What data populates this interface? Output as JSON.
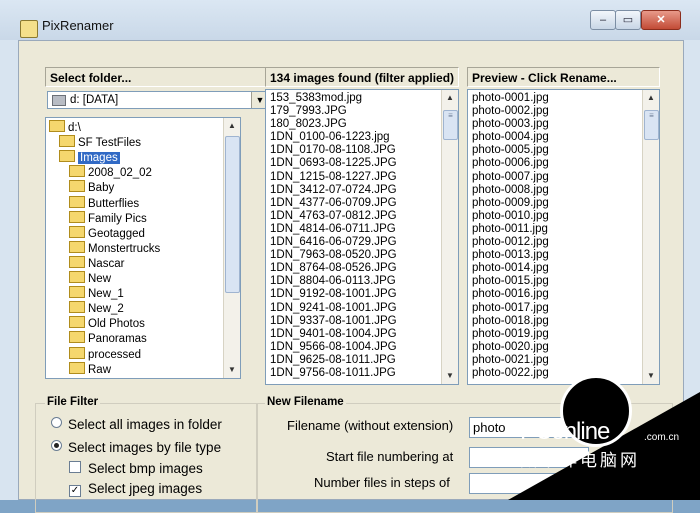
{
  "window": {
    "title": "PixRenamer",
    "controls": {
      "minimize": "–",
      "maximize": "▭",
      "close": "✕"
    }
  },
  "folder_panel": {
    "header": "Select folder...",
    "drive_combo": {
      "value": "d: [DATA]"
    },
    "tree": [
      {
        "label": "d:\\",
        "selected": false
      },
      {
        "label": "SF TestFiles",
        "selected": false
      },
      {
        "label": "Images",
        "selected": true
      },
      {
        "label": "2008_02_02",
        "selected": false
      },
      {
        "label": "Baby",
        "selected": false
      },
      {
        "label": "Butterflies",
        "selected": false
      },
      {
        "label": "Family Pics",
        "selected": false
      },
      {
        "label": "Geotagged",
        "selected": false
      },
      {
        "label": "Monstertrucks",
        "selected": false
      },
      {
        "label": "Nascar",
        "selected": false
      },
      {
        "label": "New",
        "selected": false
      },
      {
        "label": "New_1",
        "selected": false
      },
      {
        "label": "New_2",
        "selected": false
      },
      {
        "label": "Old Photos",
        "selected": false
      },
      {
        "label": "Panoramas",
        "selected": false
      },
      {
        "label": "processed",
        "selected": false
      },
      {
        "label": "Raw",
        "selected": false
      }
    ]
  },
  "images_panel": {
    "header": "134 images found (filter applied)",
    "files": [
      "153_5383mod.jpg",
      "179_7993.JPG",
      "180_8023.JPG",
      "1DN_0100-06-1223.jpg",
      "1DN_0170-08-1108.JPG",
      "1DN_0693-08-1225.JPG",
      "1DN_1215-08-1227.JPG",
      "1DN_3412-07-0724.JPG",
      "1DN_4377-06-0709.JPG",
      "1DN_4763-07-0812.JPG",
      "1DN_4814-06-0711.JPG",
      "1DN_6416-06-0729.JPG",
      "1DN_7963-08-0520.JPG",
      "1DN_8764-08-0526.JPG",
      "1DN_8804-06-0113.JPG",
      "1DN_9192-08-1001.JPG",
      "1DN_9241-08-1001.JPG",
      "1DN_9337-08-1001.JPG",
      "1DN_9401-08-1004.JPG",
      "1DN_9566-08-1004.JPG",
      "1DN_9625-08-1011.JPG",
      "1DN_9756-08-1011.JPG"
    ]
  },
  "preview_panel": {
    "header": "Preview - Click Rename...",
    "files": [
      "photo-0001.jpg",
      "photo-0002.jpg",
      "photo-0003.jpg",
      "photo-0004.jpg",
      "photo-0005.jpg",
      "photo-0006.jpg",
      "photo-0007.jpg",
      "photo-0008.jpg",
      "photo-0009.jpg",
      "photo-0010.jpg",
      "photo-0011.jpg",
      "photo-0012.jpg",
      "photo-0013.jpg",
      "photo-0014.jpg",
      "photo-0015.jpg",
      "photo-0016.jpg",
      "photo-0017.jpg",
      "photo-0018.jpg",
      "photo-0019.jpg",
      "photo-0020.jpg",
      "photo-0021.jpg",
      "photo-0022.jpg"
    ]
  },
  "file_filter": {
    "title": "File Filter",
    "all_images": "Select all images in folder",
    "by_type": "Select images by file type",
    "bmp": "Select bmp images",
    "jpeg": "Select jpeg images",
    "selected_option": "by_type",
    "jpeg_checked": true,
    "bmp_checked": false
  },
  "new_filename": {
    "title": "New Filename",
    "filename_label": "Filename (without extension)",
    "filename_value": "photo",
    "start_label": "Start file numbering at",
    "start_value": "",
    "steps_label": "Number files in steps of",
    "steps_value": ""
  },
  "watermark": {
    "brand": "PConline",
    "domain": ".com.cn",
    "chinese": "太平洋电脑网"
  }
}
